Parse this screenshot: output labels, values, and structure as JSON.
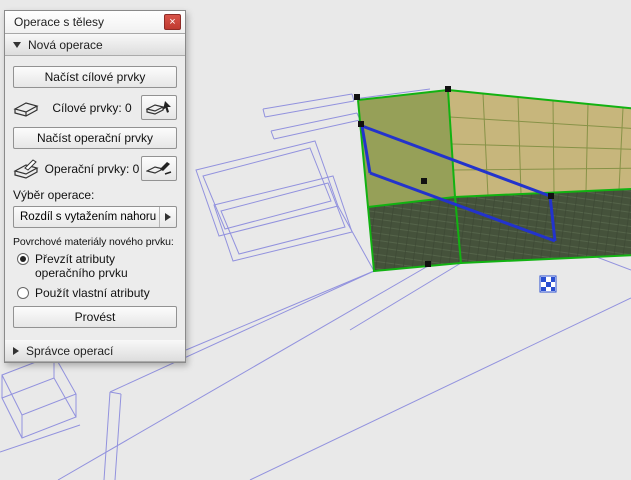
{
  "panel": {
    "title": "Operace s tělesy",
    "close_glyph": "×",
    "sections": {
      "new_operation": {
        "label": "Nová operace"
      },
      "operation_manager": {
        "label": "Správce operací"
      }
    },
    "buttons": {
      "load_targets": "Načíst cílové prvky",
      "load_operators": "Načíst operační prvky",
      "execute": "Provést"
    },
    "counters": {
      "targets": "Cílové prvky: 0",
      "operators": "Operační prvky: 0"
    },
    "operation": {
      "label": "Výběr operace:",
      "selected": "Rozdíl s vytažením nahoru"
    },
    "surface": {
      "label": "Povrchové materiály nového prvku:",
      "option_inherit": "Převzít atributy operačního prvku",
      "option_custom": "Použít vlastní atributy"
    }
  },
  "icons": {
    "close": "close-icon",
    "collapse_open": "chevron-down-icon",
    "collapse_closed": "chevron-right-icon",
    "target_elements": "target-slab-icon",
    "pick_target": "pick-target-icon",
    "operator_elements": "operator-slab-icon",
    "pick_operator": "pick-operator-icon",
    "flyout": "flyout-arrow-icon",
    "badge": "checker-badge-icon"
  },
  "viewport": {
    "colors": {
      "background": "#e9e9e9",
      "wireframe": "#9292de",
      "selection_green": "#12b212",
      "selection_blue": "#2333cc",
      "slab_top": "#c7b67c",
      "slab_ledge": "#96a058",
      "slab_side": "#45523b",
      "handle": "#111111"
    }
  }
}
